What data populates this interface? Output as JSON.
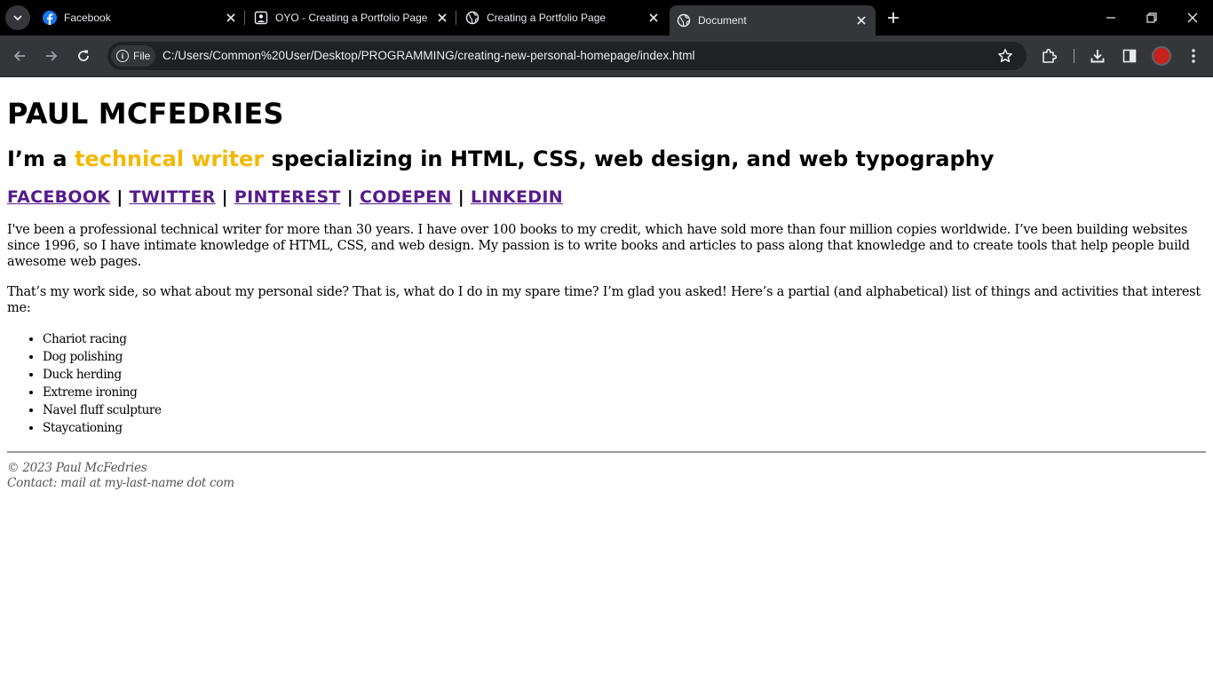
{
  "browser": {
    "tabs": [
      {
        "title": "Facebook",
        "icon": "facebook-icon"
      },
      {
        "title": "OYO - Creating a Portfolio Page",
        "icon": "portrait-icon"
      },
      {
        "title": "Creating a Portfolio Page",
        "icon": "globe-icon"
      },
      {
        "title": "Document",
        "icon": "globe-icon",
        "active": true
      }
    ],
    "site_chip": "File",
    "url": "C:/Users/Common%20User/Desktop/PROGRAMMING/creating-new-personal-homepage/index.html",
    "colors": {
      "tabstrip": "#000000",
      "toolbar": "#35363a",
      "omnibox": "#202124",
      "facebook": "#1877f2"
    }
  },
  "page": {
    "name": "PAUL MCFEDRIES",
    "tagline_prefix": "I’m a ",
    "tagline_highlight": "technical writer",
    "tagline_suffix": " specializing in HTML, CSS, web design, and web typography",
    "social_links": [
      "FACEBOOK",
      "TWITTER",
      "PINTEREST",
      "CODEPEN",
      "LINKEDIN"
    ],
    "separator": "|",
    "paragraph1": "I've been a professional technical writer for more than 30 years. I have over 100 books to my credit, which have sold more than four million copies worldwide. I’ve been building websites since 1996, so I have intimate knowledge of HTML, CSS, and web design. My passion is to write books and articles to pass along that knowledge and to create tools that help people build awesome web pages.",
    "paragraph2": "That’s my work side, so what about my personal side? That is, what do I do in my spare time? I’m glad you asked! Here’s a partial (and alphabetical) list of things and activities that interest me:",
    "interests": [
      "Chariot racing",
      "Dog polishing",
      "Duck herding",
      "Extreme ironing",
      "Navel fluff sculpture",
      "Staycationing"
    ],
    "footer_copyright": "© 2023 Paul McFedries",
    "footer_contact": "Contact: mail at my-last-name dot com",
    "colors": {
      "accent": "#f5b800",
      "link": "#551a8b",
      "footer_text": "#555555"
    }
  }
}
